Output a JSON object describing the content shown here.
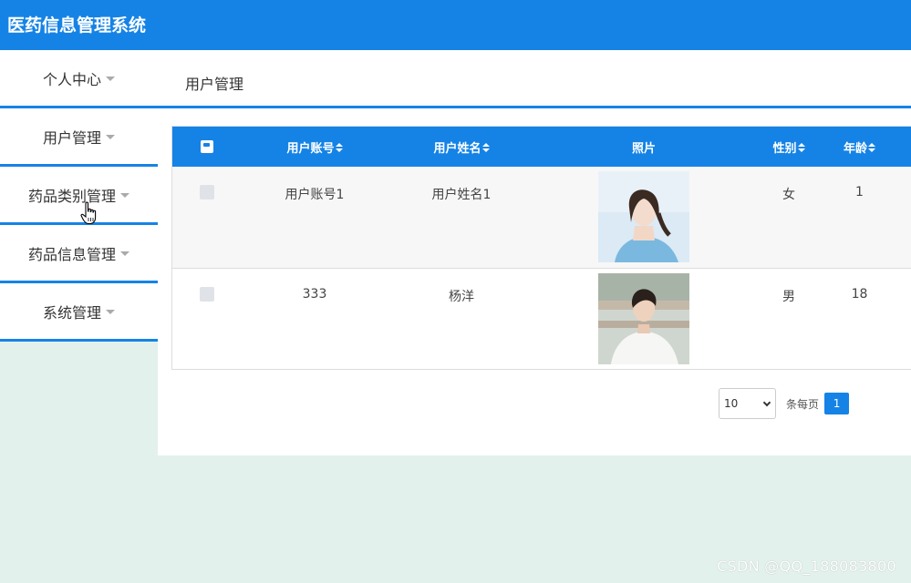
{
  "app": {
    "title": "医药信息管理系统"
  },
  "sidebar": {
    "items": [
      {
        "label": "个人中心"
      },
      {
        "label": "用户管理"
      },
      {
        "label": "药品类别管理"
      },
      {
        "label": "药品信息管理"
      },
      {
        "label": "系统管理"
      }
    ]
  },
  "breadcrumb": {
    "current": "用户管理"
  },
  "table": {
    "columns": [
      "用户账号",
      "用户姓名",
      "照片",
      "性别",
      "年龄"
    ],
    "rows": [
      {
        "account": "用户账号1",
        "name": "用户姓名1",
        "photo": "woman-portrait",
        "gender": "女",
        "age": "1"
      },
      {
        "account": "333",
        "name": "杨洋",
        "photo": "man-portrait",
        "gender": "男",
        "age": "18"
      }
    ]
  },
  "pagination": {
    "page_size": "10",
    "per_page_label": "条每页",
    "current_page": "1"
  },
  "watermark": "CSDN @QQ_188083800",
  "colors": {
    "primary": "#1583e6",
    "background": "#e3f1ec"
  }
}
